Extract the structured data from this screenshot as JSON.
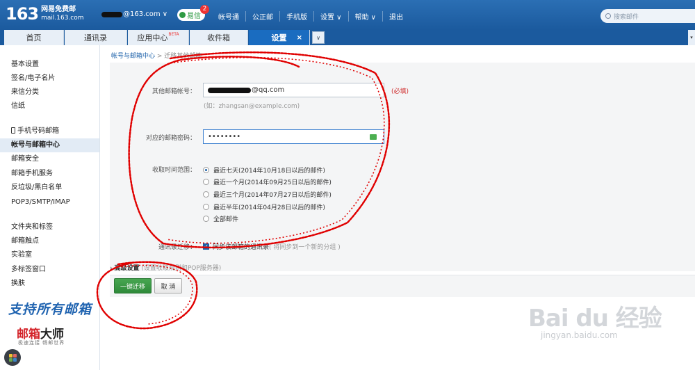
{
  "header": {
    "logo_num": "163",
    "logo_line1": "网易免费邮",
    "logo_line2": "mail.163.com",
    "account": "@163.com ∨",
    "yixin_label": "易信",
    "yixin_badge": "2",
    "links": [
      "帐号通",
      "公正邮",
      "手机版",
      "设置 ∨",
      "帮助 ∨",
      "退出"
    ],
    "search_placeholder": "搜索邮件"
  },
  "tabs": [
    {
      "label": "首页"
    },
    {
      "label": "通讯录"
    },
    {
      "label": "应用中心",
      "beta": "BETA"
    },
    {
      "label": "收件箱"
    },
    {
      "label": "设置",
      "close": "×"
    }
  ],
  "tab_dropdown": "∨",
  "sidebar": {
    "group1": [
      "基本设置",
      "签名/电子名片",
      "来信分类",
      "信纸"
    ],
    "group2": [
      "手机号码邮箱",
      "帐号与邮箱中心",
      "邮箱安全",
      "邮箱手机服务",
      "反垃圾/黑白名单",
      "POP3/SMTP/IMAP"
    ],
    "group3": [
      "文件夹和标签",
      "邮箱触点",
      "实验室",
      "多标签窗口",
      "换肤"
    ],
    "promo_line1": "支持所有邮箱",
    "promo_brand_red": "邮箱",
    "promo_brand_black": "大师",
    "promo_tagline": "极速连接 畅邮世界"
  },
  "breadcrumb": {
    "root": "帐号与邮箱中心",
    "sep": " > ",
    "current": "迁移其他邮箱"
  },
  "form": {
    "email_label": "其他邮箱帐号：",
    "email_value": "@qq.com",
    "required": "(必填)",
    "email_hint": "(如：zhangsan@example.com)",
    "password_label": "对应的邮箱密码：",
    "password_value": "••••••••",
    "range_label": "收取时间范围：",
    "ranges": [
      "最近七天(2014年10月18日以后的邮件)",
      "最近一个月(2014年09月25日以后的邮件)",
      "最近三个月(2014年07月27日以后的邮件)",
      "最近半年(2014年04月28日以后的邮件)",
      "全部邮件"
    ],
    "selected_range": 0,
    "contacts_label": "通讯录迁移：",
    "contacts_check": "同步该邮箱的通讯录",
    "contacts_sub": "( 将同步到一个新的分组 )",
    "advanced_title": "高级设置",
    "advanced_sub": "(设置收取规则和POP服务器)",
    "submit": "一键迁移",
    "cancel": "取 消"
  },
  "watermark": {
    "logo": "Bai du 经验",
    "url": "jingyan.baidu.com"
  },
  "colors": {
    "header": "#1b5a9e",
    "active_tab": "#1a6cc0",
    "primary_button": "#3a9a45",
    "required": "#d03030",
    "scribble": "#e00000"
  }
}
